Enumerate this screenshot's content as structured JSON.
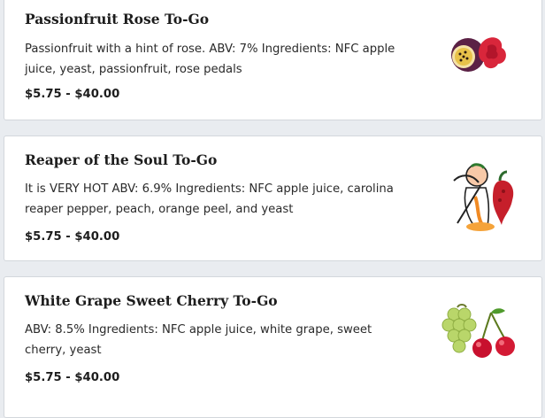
{
  "products": [
    {
      "name": "Passionfruit Rose To-Go",
      "description": "Passionfruit with a hint of rose. ABV: 7% Ingredients: NFC apple juice, yeast, passionfruit, rose pedals",
      "price": "$5.75 - $40.00",
      "image_icon": "passionfruit-rose-icon"
    },
    {
      "name": "Reaper of the Soul To-Go",
      "description": "It is VERY HOT ABV: 6.9% Ingredients: NFC apple juice, carolina reaper pepper, peach, orange peel, and yeast",
      "price": "$5.75 - $40.00",
      "image_icon": "reaper-pepper-peach-icon"
    },
    {
      "name": "White Grape Sweet Cherry To-Go",
      "description": "ABV: 8.5% Ingredients: NFC apple juice, white grape, sweet cherry, yeast",
      "price": "$5.75 - $40.00",
      "image_icon": "grape-cherry-icon"
    }
  ]
}
